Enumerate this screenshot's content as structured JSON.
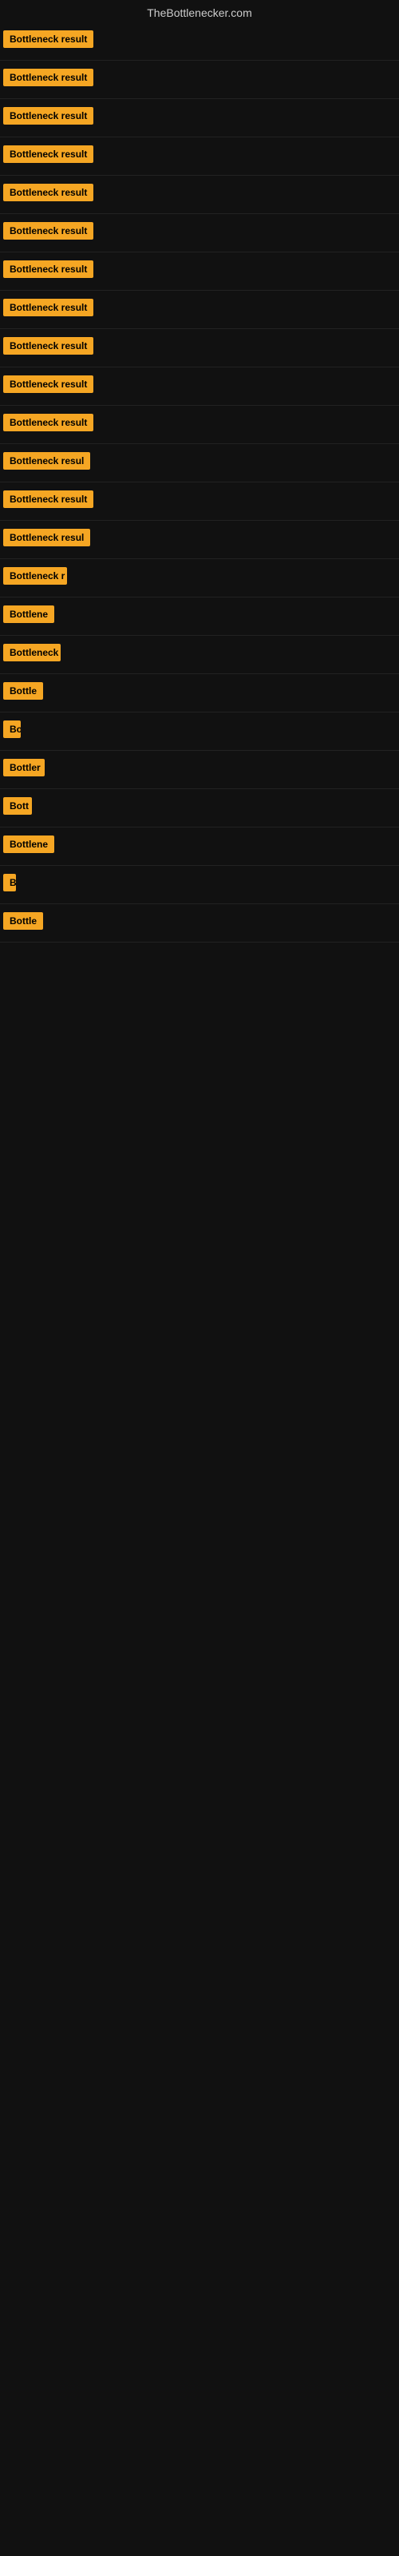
{
  "site": {
    "title": "TheBottlenecker.com"
  },
  "rows": [
    {
      "id": 1,
      "label": "Bottleneck result",
      "width": 120
    },
    {
      "id": 2,
      "label": "Bottleneck result",
      "width": 120
    },
    {
      "id": 3,
      "label": "Bottleneck result",
      "width": 120
    },
    {
      "id": 4,
      "label": "Bottleneck result",
      "width": 120
    },
    {
      "id": 5,
      "label": "Bottleneck result",
      "width": 120
    },
    {
      "id": 6,
      "label": "Bottleneck result",
      "width": 120
    },
    {
      "id": 7,
      "label": "Bottleneck result",
      "width": 120
    },
    {
      "id": 8,
      "label": "Bottleneck result",
      "width": 120
    },
    {
      "id": 9,
      "label": "Bottleneck result",
      "width": 120
    },
    {
      "id": 10,
      "label": "Bottleneck result",
      "width": 120
    },
    {
      "id": 11,
      "label": "Bottleneck result",
      "width": 120
    },
    {
      "id": 12,
      "label": "Bottleneck resul",
      "width": 110
    },
    {
      "id": 13,
      "label": "Bottleneck result",
      "width": 120
    },
    {
      "id": 14,
      "label": "Bottleneck resul",
      "width": 110
    },
    {
      "id": 15,
      "label": "Bottleneck r",
      "width": 80
    },
    {
      "id": 16,
      "label": "Bottlene",
      "width": 65
    },
    {
      "id": 17,
      "label": "Bottleneck",
      "width": 72
    },
    {
      "id": 18,
      "label": "Bottle",
      "width": 50
    },
    {
      "id": 19,
      "label": "Bo",
      "width": 22
    },
    {
      "id": 20,
      "label": "Bottler",
      "width": 52
    },
    {
      "id": 21,
      "label": "Bott",
      "width": 36
    },
    {
      "id": 22,
      "label": "Bottlene",
      "width": 65
    },
    {
      "id": 23,
      "label": "B",
      "width": 14
    },
    {
      "id": 24,
      "label": "Bottle",
      "width": 50
    }
  ],
  "colors": {
    "badge_bg": "#f5a623",
    "badge_text": "#000000",
    "background": "#111111",
    "title_text": "#cccccc"
  }
}
